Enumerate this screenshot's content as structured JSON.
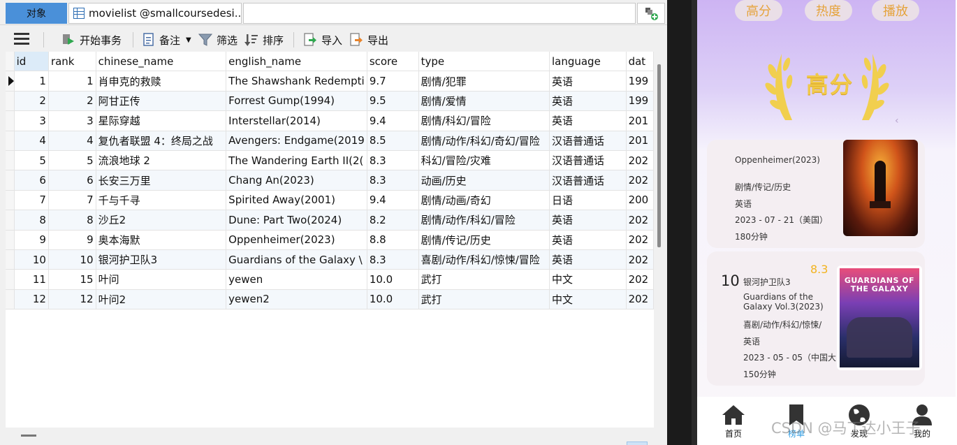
{
  "tabs": {
    "objects": "对象",
    "table": "movielist @smallcoursedesi..."
  },
  "toolbar": {
    "begin_transaction": "开始事务",
    "memo": "备注",
    "filter": "筛选",
    "sort": "排序",
    "import": "导入",
    "export": "导出"
  },
  "grid": {
    "columns": [
      "id",
      "rank",
      "chinese_name",
      "english_name",
      "score",
      "type",
      "language",
      "dat"
    ],
    "rows": [
      [
        "1",
        "1",
        "肖申克的救赎",
        "The Shawshank Redempti",
        "9.7",
        "剧情/犯罪",
        "英语",
        "199"
      ],
      [
        "2",
        "2",
        "阿甘正传",
        "Forrest Gump(1994)",
        "9.5",
        "剧情/爱情",
        "英语",
        "199"
      ],
      [
        "3",
        "3",
        "星际穿越",
        "Interstellar(2014)",
        "9.4",
        "剧情/科幻/冒险",
        "英语",
        "201"
      ],
      [
        "4",
        "4",
        "复仇者联盟 4：终局之战",
        "Avengers: Endgame(2019",
        "8.5",
        "剧情/动作/科幻/奇幻/冒险",
        "汉语普通话",
        "201"
      ],
      [
        "5",
        "5",
        "流浪地球 2",
        "The Wandering Earth II(2(",
        "8.3",
        "科幻/冒险/灾难",
        "汉语普通话",
        "202"
      ],
      [
        "6",
        "6",
        "长安三万里",
        "Chang An(2023)",
        "8.3",
        "动画/历史",
        "汉语普通话",
        "202"
      ],
      [
        "7",
        "7",
        "千与千寻",
        "Spirited Away(2001)",
        "9.4",
        "剧情/动画/奇幻",
        "日语",
        "200"
      ],
      [
        "8",
        "8",
        "沙丘2",
        "Dune: Part Two(2024)",
        "8.2",
        "剧情/动作/科幻/冒险",
        "英语",
        "202"
      ],
      [
        "9",
        "9",
        "奥本海默",
        "Oppenheimer(2023)",
        "8.8",
        "剧情/传记/历史",
        "英语",
        "202"
      ],
      [
        "10",
        "10",
        "银河护卫队3",
        "Guardians of the Galaxy \\",
        "8.3",
        "喜剧/动作/科幻/惊悚/冒险",
        "英语",
        "202"
      ],
      [
        "11",
        "15",
        "叶问",
        "yewen",
        "10.0",
        "武打",
        "中文",
        "202"
      ],
      [
        "12",
        "12",
        "叶问2",
        "yewen2",
        "10.0",
        "武打",
        "中文",
        "202"
      ]
    ]
  },
  "phone": {
    "tabs": [
      "高分",
      "热度",
      "播放"
    ],
    "badge": "高分",
    "card1": {
      "english": "Oppenheimer(2023)",
      "type": "剧情/传记/历史",
      "language": "英语",
      "date": "2023 - 07 - 21（美国）",
      "duration": "180分钟"
    },
    "card2": {
      "rank": "10",
      "chinese": "银河护卫队3",
      "english_line1": "Guardians of the",
      "english_line2": "Galaxy Vol.3(2023)",
      "score": "8.3",
      "type": "喜剧/动作/科幻/惊悚/",
      "language": "英语",
      "date": "2023 - 05 - 05（中国大",
      "duration": "150分钟",
      "poster_title": "GUARDIANS OF THE GALAXY"
    },
    "nav": [
      "首页",
      "榜单",
      "发现",
      "我的"
    ],
    "watermark": "CSDN @马丁达小王子"
  },
  "colors": {
    "accent_tab": "#4a90d9",
    "phone_gold": "#e5a33b",
    "score_gold": "#f2b31f"
  }
}
